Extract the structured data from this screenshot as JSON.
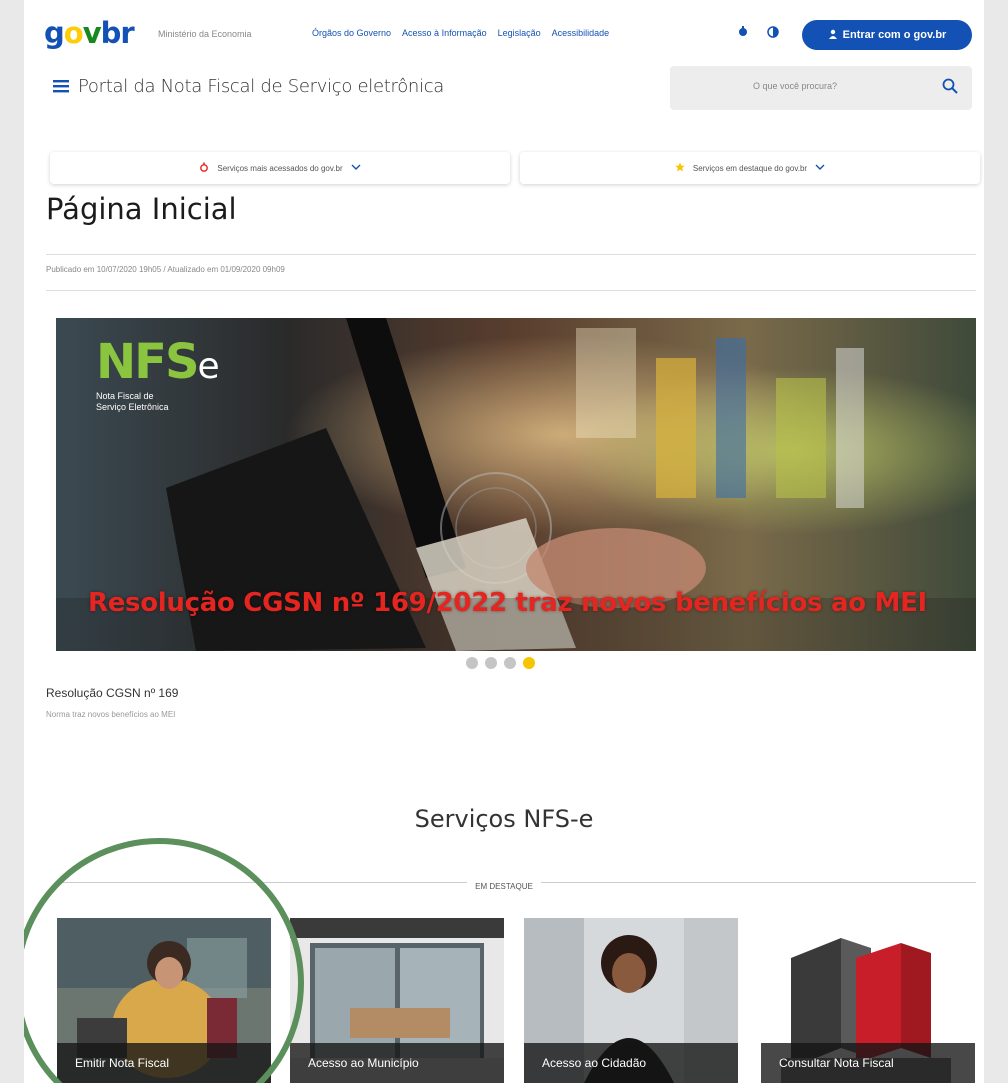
{
  "topbar": {
    "logo": {
      "g": "g",
      "o": "o",
      "v": "v",
      "b": "b",
      "r": "r"
    },
    "ministry": "Ministério da Economia",
    "nav": [
      "Órgãos do Governo",
      "Acesso à Informação",
      "Legislação",
      "Acessibilidade"
    ],
    "login_label": "Entrar com o gov.br"
  },
  "header": {
    "title": "Portal da Nota Fiscal de Serviço eletrônica",
    "search_placeholder": "O que você procura?"
  },
  "pills": {
    "left": "Serviços mais acessados do gov.br",
    "right": "Serviços em destaque do gov.br"
  },
  "page": {
    "title": "Página Inicial",
    "published": "Publicado em 10/07/2020 19h05   /   Atualizado em 01/09/2020 09h09"
  },
  "banner": {
    "logo_text": "NFS",
    "logo_e": "e",
    "logo_sub": "Nota Fiscal de\nServiço Eletrônica",
    "caption": "Resolução CGSN nº 169/2022 traz novos benefícios ao MEI",
    "slide_count": 4,
    "active_slide": 4
  },
  "slide": {
    "title": "Resolução CGSN nº 169",
    "subtitle": "Norma traz novos benefícios ao MEI"
  },
  "services": {
    "title": "Serviços NFS-e",
    "section_label": "EM DESTAQUE",
    "cards": [
      {
        "label": "Emitir Nota Fiscal"
      },
      {
        "label": "Acesso ao Município"
      },
      {
        "label": "Acesso ao Cidadão"
      },
      {
        "label": "Consultar Nota Fiscal"
      }
    ]
  },
  "colors": {
    "primary": "#1351b4",
    "accent_yellow": "#f7c400",
    "caption_red": "#e52520",
    "nfse_green": "#8bc43f",
    "highlight_circle": "#5b8f5b"
  },
  "icons": [
    "hamburger-icon",
    "search-icon",
    "user-icon",
    "cookie-icon",
    "contrast-icon",
    "chevron-down-icon",
    "star-icon"
  ]
}
